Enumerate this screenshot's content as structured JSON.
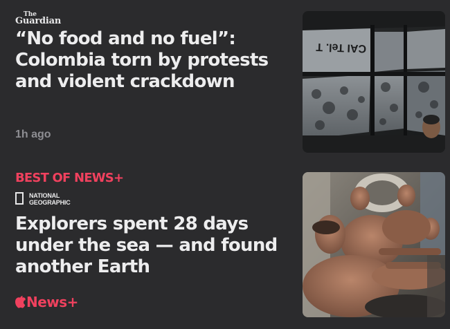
{
  "story1": {
    "publisher": {
      "line1": "The",
      "line2": "Guardian"
    },
    "headline": "“No food and no fuel”: Colombia torn by protests and violent crackdown",
    "timestamp": "1h ago",
    "image_sign_text": "CAI Tel. T"
  },
  "story2": {
    "label": "BEST OF NEWS+",
    "publisher": {
      "line1": "NATIONAL",
      "line2": "GEOGRAPHIC"
    },
    "headline": "Explorers spent 28 days under the sea — and found another Earth",
    "badge": "News+"
  },
  "colors": {
    "accent": "#f0415e",
    "background": "#2b2b2d",
    "text": "#ededee",
    "muted": "#8e8e93"
  },
  "icons": {
    "apple": "apple-icon",
    "natgeo": "natgeo-frame-icon"
  }
}
